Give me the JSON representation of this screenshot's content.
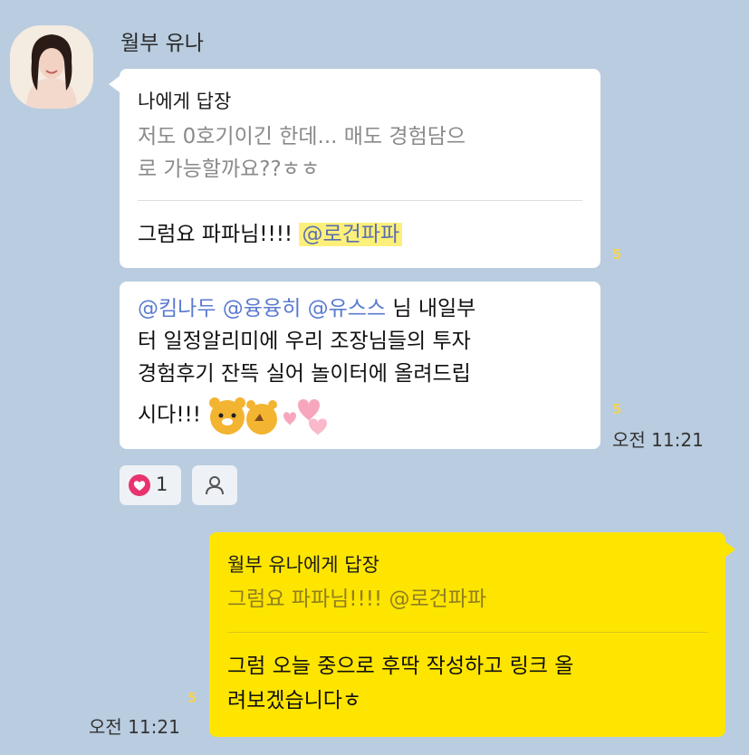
{
  "sender": {
    "name": "월부 유나"
  },
  "bubble1": {
    "reply_header": "나에게 답장",
    "quote_line1": "저도 0호기이긴 한데... 매도 경험담으",
    "quote_line2": "로 가능할까요??ㅎㅎ",
    "msg_prefix": "그럼요 파파님!!!! ",
    "mention": "@로건파파",
    "unread": "5"
  },
  "bubble2": {
    "mentions": [
      "@킴나두",
      "@융융히",
      "@유스스"
    ],
    "line1_suffix": " 님 내일부",
    "line2": "터 일정알리미에 우리 조장님들의 투자",
    "line3": "경험후기 잔뜩 실어 놀이터에 올려드립",
    "line4": "시다!!! ",
    "unread": "5",
    "time": "오전 11:21"
  },
  "reactions": {
    "heart_count": "1"
  },
  "my_bubble": {
    "reply_header": "월부 유나에게 답장",
    "quote": "그럼요 파파님!!!! @로건파파",
    "line1": "그럼 오늘 중으로 후딱 작성하고 링크 올",
    "line2": "려보겠습니다ㅎ",
    "unread": "5",
    "time": "오전 11:21"
  },
  "colors": {
    "background": "#b9cce0",
    "my_bubble": "#fee500",
    "mention": "#5b7bd0",
    "unread": "#f2d35a",
    "heart": "#e8336e"
  },
  "icons": [
    "profile-photo",
    "heart-icon",
    "person-icon",
    "ryan-emoticon"
  ]
}
